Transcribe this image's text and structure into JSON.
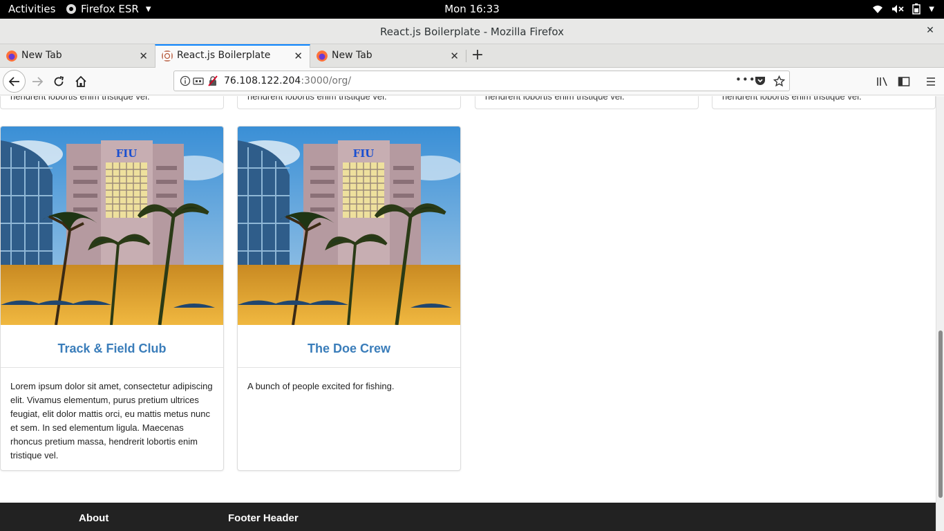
{
  "system_bar": {
    "activities": "Activities",
    "app_name": "Firefox ESR",
    "clock": "Mon 16:33"
  },
  "window": {
    "title": "React.js Boilerplate - Mozilla Firefox",
    "close": "✕"
  },
  "tabs": [
    {
      "label": "New Tab",
      "active": false
    },
    {
      "label": "React.js Boilerplate",
      "active": true
    },
    {
      "label": "New Tab",
      "active": false
    }
  ],
  "navigation": {
    "url_host": "76.108.122.204",
    "url_rest": ":3000/org/",
    "page_actions": "•••"
  },
  "page": {
    "prev_row_text": "hendrerit lobortis enim tristique vel.",
    "cards": [
      {
        "name": "Track & Field Club",
        "description": "Lorem ipsum dolor sit amet, consectetur adipiscing elit. Vivamus elementum, purus pretium ultrices feugiat, elit dolor mattis orci, eu mattis metus nunc et sem. In sed elementum ligula. Maecenas rhoncus pretium massa, hendrerit lobortis enim tristique vel.",
        "photo_sign": "FIU"
      },
      {
        "name": "The Doe Crew",
        "description": "A bunch of people excited for fishing.",
        "photo_sign": "FIU"
      }
    ],
    "footer": {
      "col1": "About",
      "col2": "Footer Header"
    }
  },
  "colors": {
    "accent": "#0a84ff",
    "card_title": "#3a7dba",
    "footer_bg": "#222222"
  }
}
